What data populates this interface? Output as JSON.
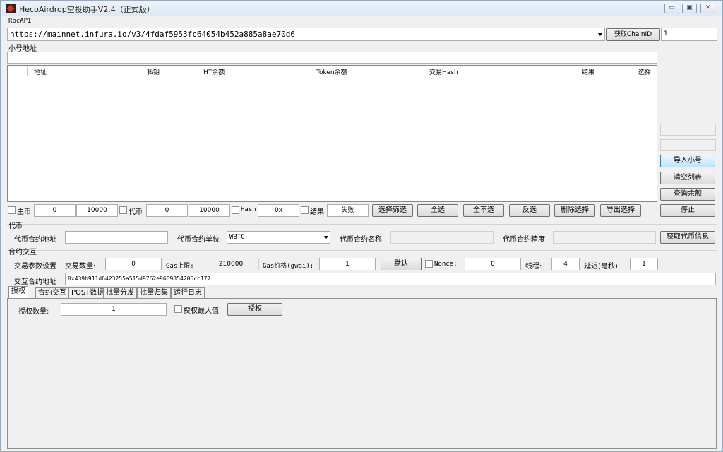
{
  "window": {
    "title": "HecoAirdrop空投助手V2.4（正式版）",
    "controls": [
      "▭",
      "▣",
      "✕"
    ]
  },
  "rpc": {
    "label": "RpcAPI",
    "url": "https://mainnet.infura.io/v3/4fdaf5953fc64054b452a885a8ae70d6",
    "get_chain_button": "获取ChainID",
    "chain_id": "1"
  },
  "accounts": {
    "label": "小号地址",
    "address_input": "",
    "columns": [
      "地址",
      "私钥",
      "HT余额",
      "Token余额",
      "交易Hash",
      "结果",
      "选择"
    ]
  },
  "right_panel": {
    "field1": "",
    "field2": "",
    "import_button": "导入小号",
    "clear_button": "清空列表",
    "query_button": "查询余额",
    "stop_button": "停止"
  },
  "filter": {
    "main_coin_label": "主币",
    "main_min": "0",
    "main_max": "10000",
    "token_label": "代币",
    "token_min": "0",
    "token_max": "10000",
    "hash_label": "Hash",
    "hash_value": "0x",
    "result_label": "结果",
    "result_value": "失败",
    "filter_button": "选择筛选",
    "select_all_button": "全选",
    "select_none_button": "全不选",
    "invert_button": "反选",
    "delete_button": "删除选择",
    "export_button": "导出选择"
  },
  "token": {
    "section_label": "代币",
    "address_label": "代币合约地址",
    "address_value": "",
    "unit_label": "代币合约单位",
    "unit_value": "WBTC",
    "name_label": "代币合约名称",
    "name_value": "",
    "precision_label": "代币合约精度",
    "precision_value": "",
    "get_info_button": "获取代币信息"
  },
  "contract": {
    "section_label": "合约交互",
    "params_label": "交易参数设置",
    "qty_label": "交易数量:",
    "qty_value": "0",
    "gas_limit_label": "Gas上限:",
    "gas_limit_value": "210000",
    "gas_price_label": "Gas价格(gwei):",
    "gas_price_value": "1",
    "default_button": "默认",
    "nonce_label": "Nonce:",
    "nonce_value": "0",
    "threads_label": "线程:",
    "threads_value": "4",
    "delay_label": "延迟(毫秒):",
    "delay_value": "1",
    "interact_address_label": "交互合约地址",
    "interact_address_value": "0x439b911d6423255a515d9762e9669854206cc177"
  },
  "tabs": [
    "授权",
    "合约交互",
    "POST数据",
    "批量分发",
    "批量归集",
    "运行日志"
  ],
  "approve": {
    "qty_label": "授权数量:",
    "qty_value": "1",
    "max_label": "授权最大值",
    "approve_button": "授权"
  }
}
